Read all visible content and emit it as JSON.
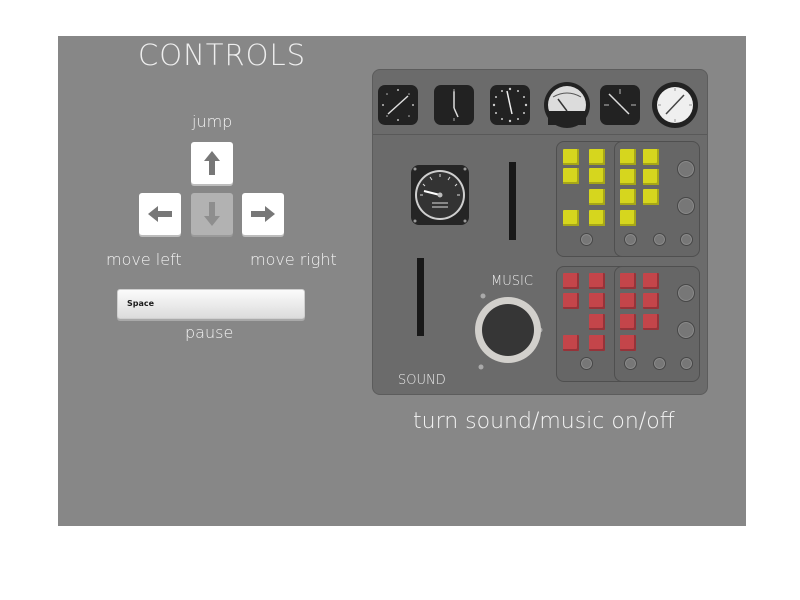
{
  "header": {
    "title": "CONTROLS"
  },
  "keys": {
    "jump_label": "jump",
    "left_label": "move left",
    "right_label": "move right",
    "pause_label": "pause",
    "space_key_label": "Space",
    "up_icon": "arrow-up-icon",
    "left_icon": "arrow-left-icon",
    "down_icon": "arrow-down-icon",
    "right_icon": "arrow-right-icon"
  },
  "console": {
    "music_label": "MUSIC",
    "sound_label": "SOUND",
    "caption": "turn sound/music on/off",
    "colors": {
      "yellow_light": "#d6d61e",
      "red_light": "#c4454a",
      "panel": "#6b6b6b"
    }
  }
}
